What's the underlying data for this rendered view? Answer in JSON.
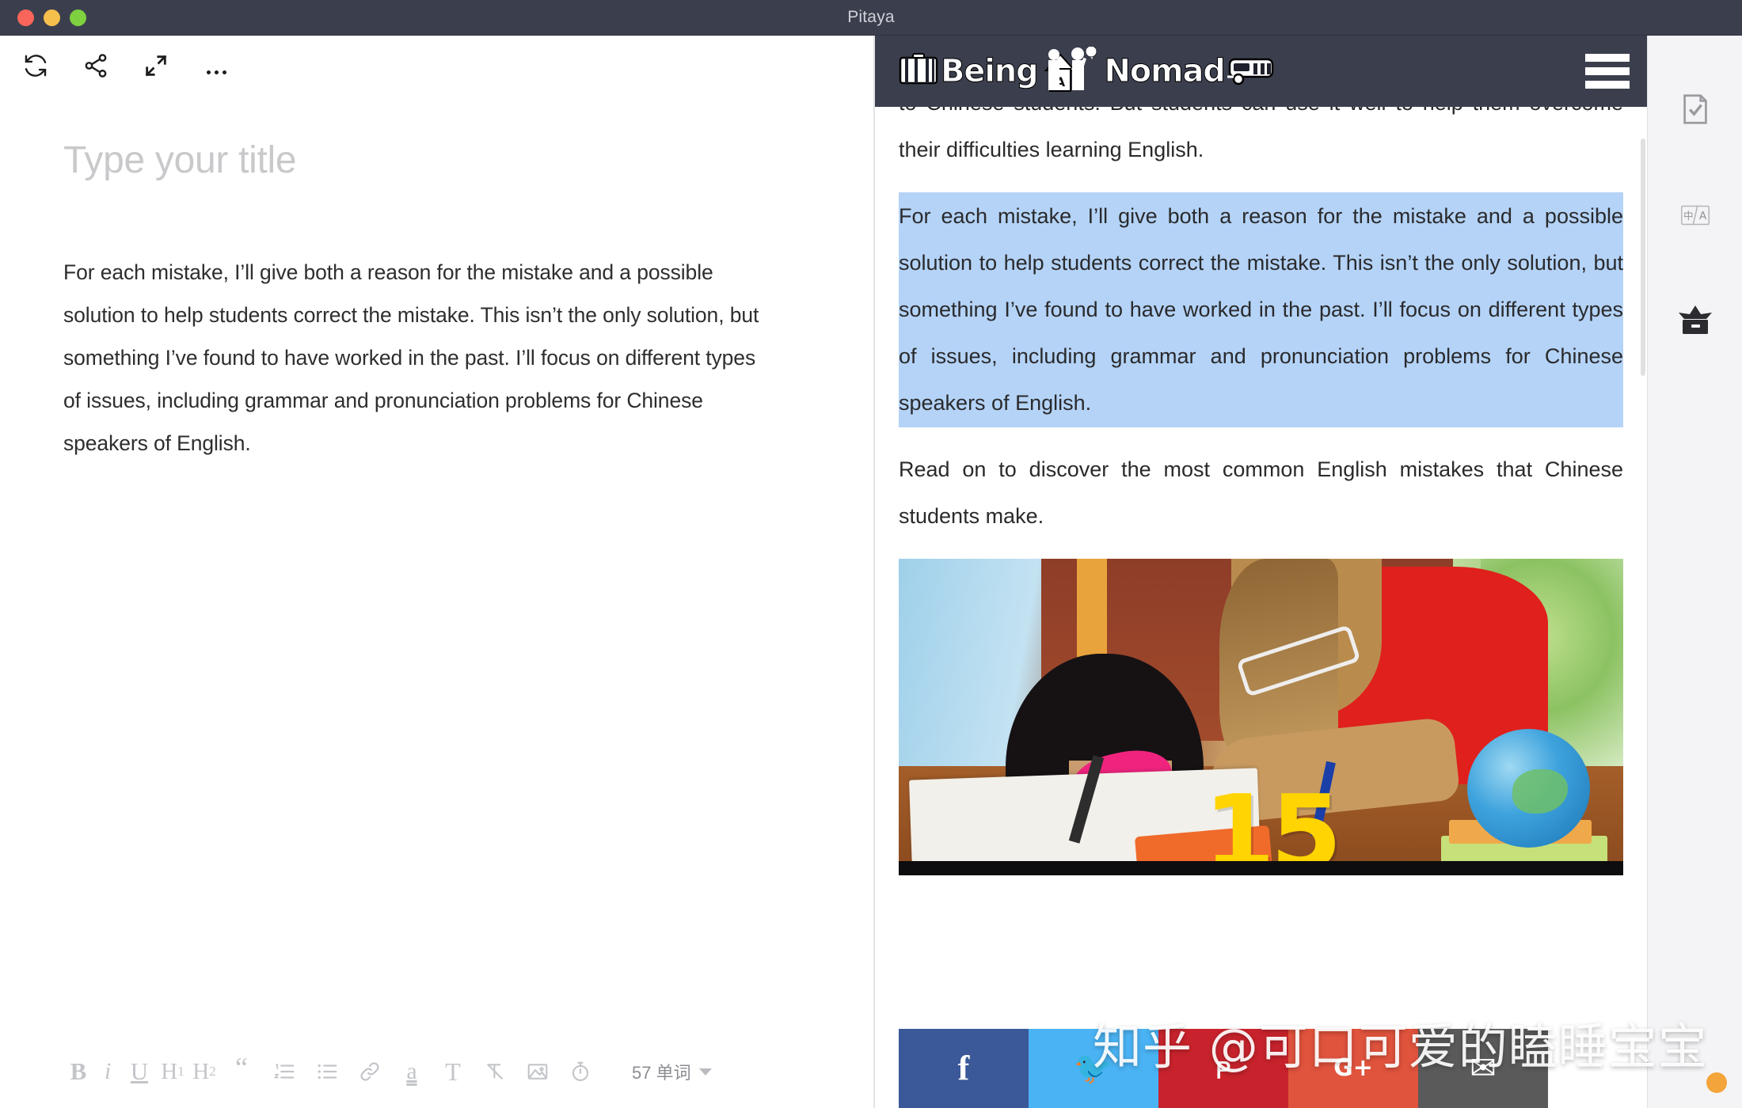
{
  "window": {
    "title": "Pitaya",
    "traffic_lights": [
      "close",
      "minimize",
      "maximize"
    ]
  },
  "editor": {
    "toolbar": [
      {
        "name": "sync-icon",
        "label": "Sync"
      },
      {
        "name": "share-icon",
        "label": "Share"
      },
      {
        "name": "fullscreen-icon",
        "label": "Fullscreen"
      },
      {
        "name": "more-options-icon",
        "label": "More"
      }
    ],
    "title_placeholder": "Type your title",
    "body_paragraphs": [
      "For each mistake, I’ll give both a reason for the mistake and a possible solution to help students correct the mistake. This isn’t the only solution, but something I’ve found to have worked in the past. I’ll focus on different types of issues, including grammar and pronunciation problems for Chinese speakers of English."
    ],
    "format_bar": {
      "bold": "B",
      "italic": "i",
      "underline": "U",
      "heading1": "H",
      "heading1_sub": "1",
      "heading2": "H",
      "heading2_sub": "2",
      "quote": "“",
      "ordered_list": "ordered-list-icon",
      "bullet_list": "bullet-list-icon",
      "link": "link-icon",
      "highlight": "a",
      "text_style": "T",
      "clear_format": "clear-format-icon",
      "image": "image-icon",
      "timer": "timer-icon",
      "word_count": "57 单词"
    }
  },
  "preview": {
    "site_header": {
      "brand_being": "Being",
      "brand_nomad": "Nomad",
      "menu": "hamburger-menu-icon"
    },
    "paragraphs": [
      {
        "id": "p-clipped",
        "text": "... to Chinese students. But students can use it as well to help them overcome their difficulties learning English.",
        "selected": false,
        "clipped": true
      },
      {
        "id": "p-selected",
        "text": "For each mistake, I’ll give both a reason for the mistake and a possible solution to help students correct the mistake. This isn’t the only solution, but something I’ve found to have worked in the past. I’ll focus on different types of issues, including grammar and pronunciation problems for Chinese speakers of English.",
        "selected": true,
        "clipped": false
      },
      {
        "id": "p-readon",
        "text": "Read on to discover the most common English mistakes that Chinese students make.",
        "selected": false,
        "clipped": false
      }
    ],
    "visible_clipped_lines": {
      "line1": "to Chinese students. But students can use it",
      "line2": "well to help them overcome their difficulties learning",
      "line3": "English."
    },
    "photo": {
      "alt": "Teacher helping a young girl with her homework at a desk with a globe",
      "overlay_number": "15"
    },
    "social_buttons": [
      {
        "name": "facebook",
        "glyph": "f",
        "color": "#3b5998"
      },
      {
        "name": "twitter",
        "glyph": "🐦",
        "color": "#4ab3f4"
      },
      {
        "name": "pinterest",
        "glyph": "ᴘ",
        "color": "#c8232c"
      },
      {
        "name": "googleplus",
        "glyph": "G+",
        "color": "#e0533d"
      },
      {
        "name": "email",
        "glyph": "✉",
        "color": "#5a5a5a"
      }
    ],
    "selection_color": "#b4d3f7"
  },
  "right_rail": [
    {
      "name": "proofread-icon",
      "label": "Proofread"
    },
    {
      "name": "translate-icon",
      "label": "Translate",
      "glyph": "中/A"
    },
    {
      "name": "archive-icon",
      "label": "Archive"
    }
  ],
  "watermark": {
    "text": "知乎 @可口可爱的瞌睡宝宝"
  },
  "colors": {
    "titlebar": "#3b3f4d",
    "selection": "#b4d3f7",
    "brand_header": "#3b3f4d",
    "rail_bg": "#f4f4f6"
  }
}
